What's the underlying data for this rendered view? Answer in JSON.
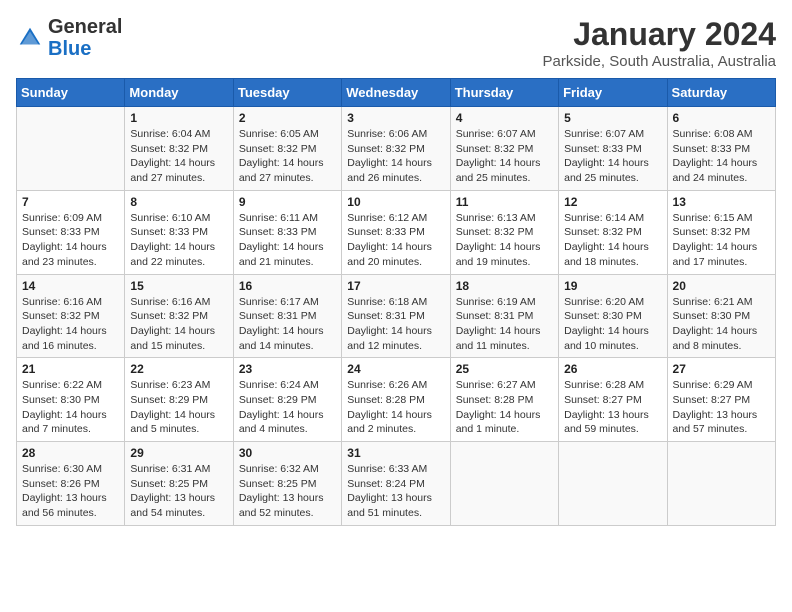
{
  "header": {
    "logo_general": "General",
    "logo_blue": "Blue",
    "title": "January 2024",
    "subtitle": "Parkside, South Australia, Australia"
  },
  "days_of_week": [
    "Sunday",
    "Monday",
    "Tuesday",
    "Wednesday",
    "Thursday",
    "Friday",
    "Saturday"
  ],
  "weeks": [
    [
      {
        "day": "",
        "info": ""
      },
      {
        "day": "1",
        "info": "Sunrise: 6:04 AM\nSunset: 8:32 PM\nDaylight: 14 hours\nand 27 minutes."
      },
      {
        "day": "2",
        "info": "Sunrise: 6:05 AM\nSunset: 8:32 PM\nDaylight: 14 hours\nand 27 minutes."
      },
      {
        "day": "3",
        "info": "Sunrise: 6:06 AM\nSunset: 8:32 PM\nDaylight: 14 hours\nand 26 minutes."
      },
      {
        "day": "4",
        "info": "Sunrise: 6:07 AM\nSunset: 8:32 PM\nDaylight: 14 hours\nand 25 minutes."
      },
      {
        "day": "5",
        "info": "Sunrise: 6:07 AM\nSunset: 8:33 PM\nDaylight: 14 hours\nand 25 minutes."
      },
      {
        "day": "6",
        "info": "Sunrise: 6:08 AM\nSunset: 8:33 PM\nDaylight: 14 hours\nand 24 minutes."
      }
    ],
    [
      {
        "day": "7",
        "info": "Sunrise: 6:09 AM\nSunset: 8:33 PM\nDaylight: 14 hours\nand 23 minutes."
      },
      {
        "day": "8",
        "info": "Sunrise: 6:10 AM\nSunset: 8:33 PM\nDaylight: 14 hours\nand 22 minutes."
      },
      {
        "day": "9",
        "info": "Sunrise: 6:11 AM\nSunset: 8:33 PM\nDaylight: 14 hours\nand 21 minutes."
      },
      {
        "day": "10",
        "info": "Sunrise: 6:12 AM\nSunset: 8:33 PM\nDaylight: 14 hours\nand 20 minutes."
      },
      {
        "day": "11",
        "info": "Sunrise: 6:13 AM\nSunset: 8:32 PM\nDaylight: 14 hours\nand 19 minutes."
      },
      {
        "day": "12",
        "info": "Sunrise: 6:14 AM\nSunset: 8:32 PM\nDaylight: 14 hours\nand 18 minutes."
      },
      {
        "day": "13",
        "info": "Sunrise: 6:15 AM\nSunset: 8:32 PM\nDaylight: 14 hours\nand 17 minutes."
      }
    ],
    [
      {
        "day": "14",
        "info": "Sunrise: 6:16 AM\nSunset: 8:32 PM\nDaylight: 14 hours\nand 16 minutes."
      },
      {
        "day": "15",
        "info": "Sunrise: 6:16 AM\nSunset: 8:32 PM\nDaylight: 14 hours\nand 15 minutes."
      },
      {
        "day": "16",
        "info": "Sunrise: 6:17 AM\nSunset: 8:31 PM\nDaylight: 14 hours\nand 14 minutes."
      },
      {
        "day": "17",
        "info": "Sunrise: 6:18 AM\nSunset: 8:31 PM\nDaylight: 14 hours\nand 12 minutes."
      },
      {
        "day": "18",
        "info": "Sunrise: 6:19 AM\nSunset: 8:31 PM\nDaylight: 14 hours\nand 11 minutes."
      },
      {
        "day": "19",
        "info": "Sunrise: 6:20 AM\nSunset: 8:30 PM\nDaylight: 14 hours\nand 10 minutes."
      },
      {
        "day": "20",
        "info": "Sunrise: 6:21 AM\nSunset: 8:30 PM\nDaylight: 14 hours\nand 8 minutes."
      }
    ],
    [
      {
        "day": "21",
        "info": "Sunrise: 6:22 AM\nSunset: 8:30 PM\nDaylight: 14 hours\nand 7 minutes."
      },
      {
        "day": "22",
        "info": "Sunrise: 6:23 AM\nSunset: 8:29 PM\nDaylight: 14 hours\nand 5 minutes."
      },
      {
        "day": "23",
        "info": "Sunrise: 6:24 AM\nSunset: 8:29 PM\nDaylight: 14 hours\nand 4 minutes."
      },
      {
        "day": "24",
        "info": "Sunrise: 6:26 AM\nSunset: 8:28 PM\nDaylight: 14 hours\nand 2 minutes."
      },
      {
        "day": "25",
        "info": "Sunrise: 6:27 AM\nSunset: 8:28 PM\nDaylight: 14 hours\nand 1 minute."
      },
      {
        "day": "26",
        "info": "Sunrise: 6:28 AM\nSunset: 8:27 PM\nDaylight: 13 hours\nand 59 minutes."
      },
      {
        "day": "27",
        "info": "Sunrise: 6:29 AM\nSunset: 8:27 PM\nDaylight: 13 hours\nand 57 minutes."
      }
    ],
    [
      {
        "day": "28",
        "info": "Sunrise: 6:30 AM\nSunset: 8:26 PM\nDaylight: 13 hours\nand 56 minutes."
      },
      {
        "day": "29",
        "info": "Sunrise: 6:31 AM\nSunset: 8:25 PM\nDaylight: 13 hours\nand 54 minutes."
      },
      {
        "day": "30",
        "info": "Sunrise: 6:32 AM\nSunset: 8:25 PM\nDaylight: 13 hours\nand 52 minutes."
      },
      {
        "day": "31",
        "info": "Sunrise: 6:33 AM\nSunset: 8:24 PM\nDaylight: 13 hours\nand 51 minutes."
      },
      {
        "day": "",
        "info": ""
      },
      {
        "day": "",
        "info": ""
      },
      {
        "day": "",
        "info": ""
      }
    ]
  ]
}
